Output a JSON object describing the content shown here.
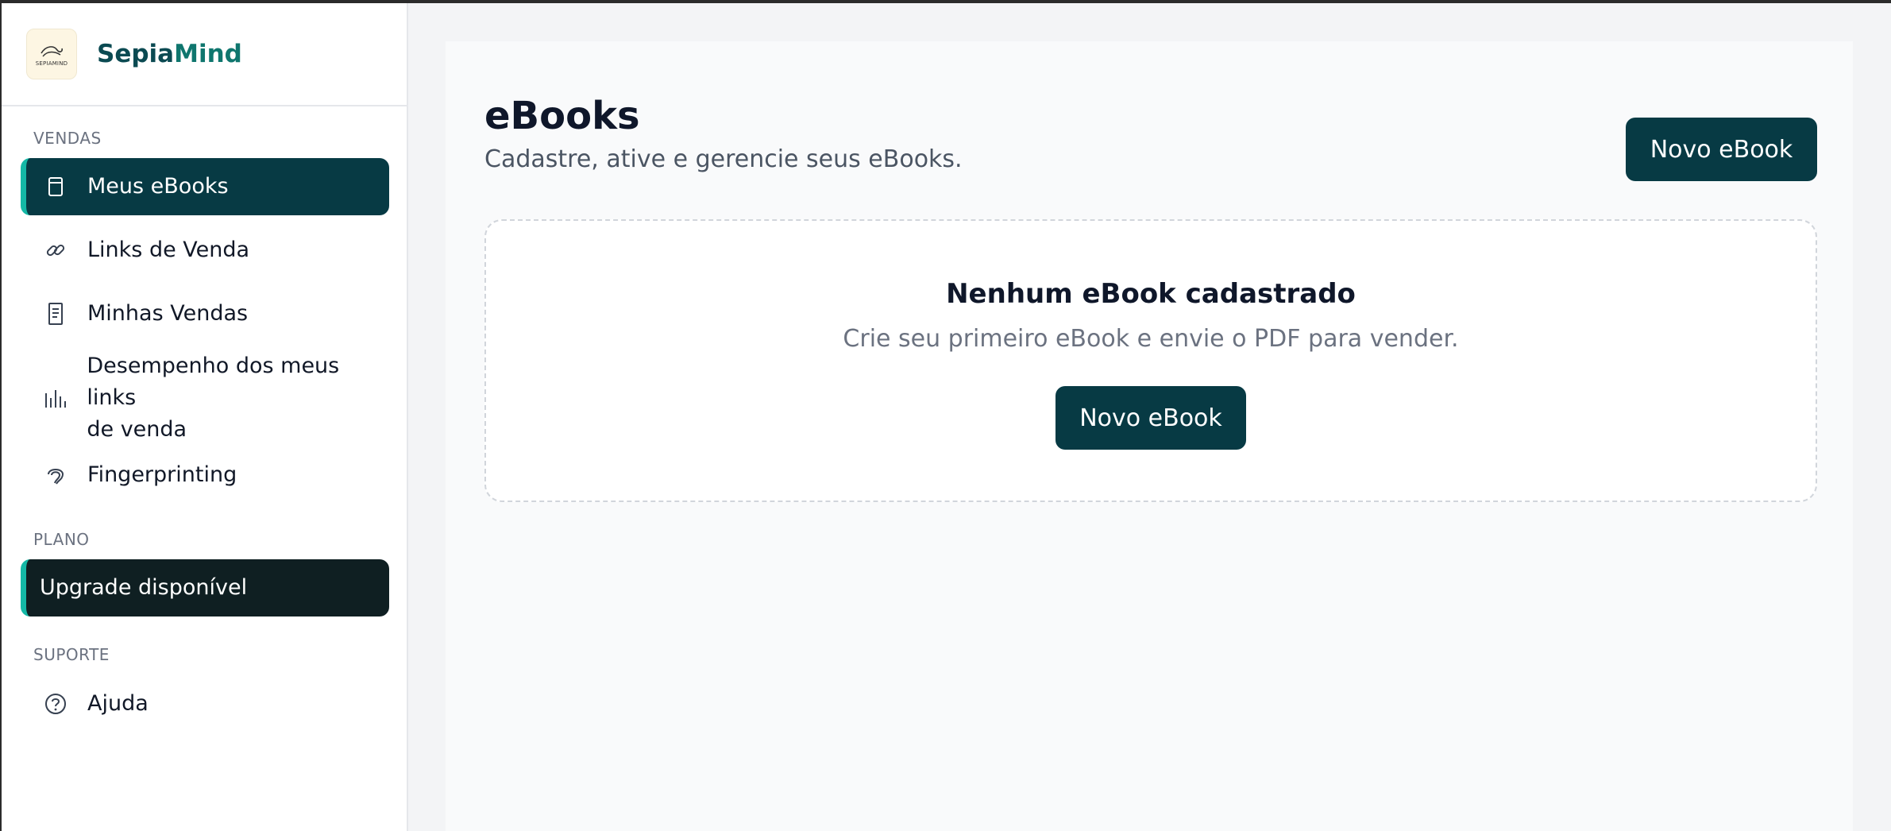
{
  "brand": {
    "name_part1": "Sepia",
    "name_part2": "Mind",
    "logo_text": "SEPIAMIND"
  },
  "sidebar": {
    "sections": {
      "vendas": "VENDAS",
      "plano": "PLANO",
      "suporte": "SUPORTE"
    },
    "items": [
      {
        "label": "Meus eBooks",
        "icon": "book-icon",
        "active": true
      },
      {
        "label": "Links de Venda",
        "icon": "link-icon"
      },
      {
        "label": "Minhas Vendas",
        "icon": "receipt-icon"
      },
      {
        "label_line1": "Desempenho dos meus links",
        "label_line2": "de venda",
        "icon": "bar-chart-icon"
      },
      {
        "label": "Fingerprinting",
        "icon": "fingerprint-icon"
      }
    ],
    "upgrade": {
      "label": "Upgrade disponível"
    },
    "help": {
      "label": "Ajuda",
      "icon": "help-circle-icon"
    }
  },
  "main": {
    "title": "eBooks",
    "subtitle": "Cadastre, ative e gerencie seus eBooks.",
    "new_button": "Novo eBook",
    "empty_state": {
      "title": "Nenhum eBook cadastrado",
      "text": "Crie seu primeiro eBook e envie o PDF para vender.",
      "button": "Novo eBook"
    }
  },
  "colors": {
    "primary": "#073a44",
    "accent": "#14b8a6",
    "brand_teal": "#0f766e"
  }
}
